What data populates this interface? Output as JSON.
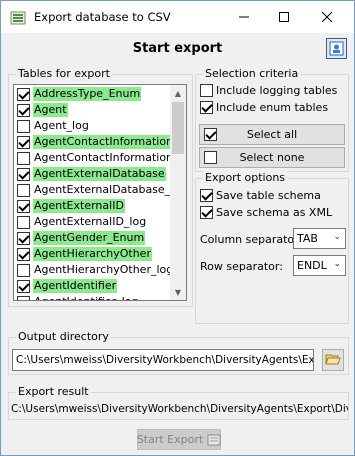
{
  "window": {
    "title": "Export database to CSV",
    "minimize_icon": "minimize-icon",
    "maximize_icon": "maximize-icon",
    "close_icon": "close-icon"
  },
  "header": {
    "title": "Start export",
    "help_icon": "help-icon"
  },
  "tables": {
    "group_label": "Tables for export",
    "highlight_color": "#8de98d",
    "items": [
      {
        "label": "AddressType_Enum",
        "checked": true,
        "highlighted": true
      },
      {
        "label": "Agent",
        "checked": true,
        "highlighted": true
      },
      {
        "label": "Agent_log",
        "checked": false,
        "highlighted": false
      },
      {
        "label": "AgentContactInformation",
        "checked": true,
        "highlighted": true
      },
      {
        "label": "AgentContactInformation_log",
        "checked": false,
        "highlighted": false
      },
      {
        "label": "AgentExternalDatabase",
        "checked": true,
        "highlighted": true
      },
      {
        "label": "AgentExternalDatabase_log",
        "checked": false,
        "highlighted": false
      },
      {
        "label": "AgentExternalID",
        "checked": true,
        "highlighted": true
      },
      {
        "label": "AgentExternalID_log",
        "checked": false,
        "highlighted": false
      },
      {
        "label": "AgentGender_Enum",
        "checked": true,
        "highlighted": true
      },
      {
        "label": "AgentHierarchyOther",
        "checked": true,
        "highlighted": true
      },
      {
        "label": "AgentHierarchyOther_log",
        "checked": false,
        "highlighted": false
      },
      {
        "label": "AgentIdentifier",
        "checked": true,
        "highlighted": true
      },
      {
        "label": "AgentIdentifier_log",
        "checked": false,
        "highlighted": false
      }
    ]
  },
  "selection": {
    "group_label": "Selection criteria",
    "include_logging_label": "Include logging tables",
    "include_logging_checked": false,
    "include_enum_label": "Include enum tables",
    "include_enum_checked": true,
    "select_all_label": "Select all",
    "select_all_checked": true,
    "select_none_label": "Select none",
    "select_none_checked": false
  },
  "export_options": {
    "group_label": "Export options",
    "save_schema_label": "Save table schema",
    "save_schema_checked": true,
    "save_schema_xml_label": "Save schema as XML",
    "save_schema_xml_checked": true,
    "column_separator_label": "Column separator:",
    "column_separator_value": "TAB",
    "row_separator_label": "Row separator:",
    "row_separator_value": "ENDL"
  },
  "output": {
    "group_label": "Output directory",
    "path": "C:\\Users\\mweiss\\DiversityWorkbench\\DiversityAgents\\Export",
    "browse_icon": "folder-open-icon"
  },
  "result": {
    "group_label": "Export result",
    "text": "C:\\Users\\mweiss\\DiversityWorkbench\\DiversityAgents\\Export\\Diversity"
  },
  "footer": {
    "start_export_label": "Start Export",
    "start_export_enabled": false,
    "export_icon": "csv-export-icon"
  }
}
